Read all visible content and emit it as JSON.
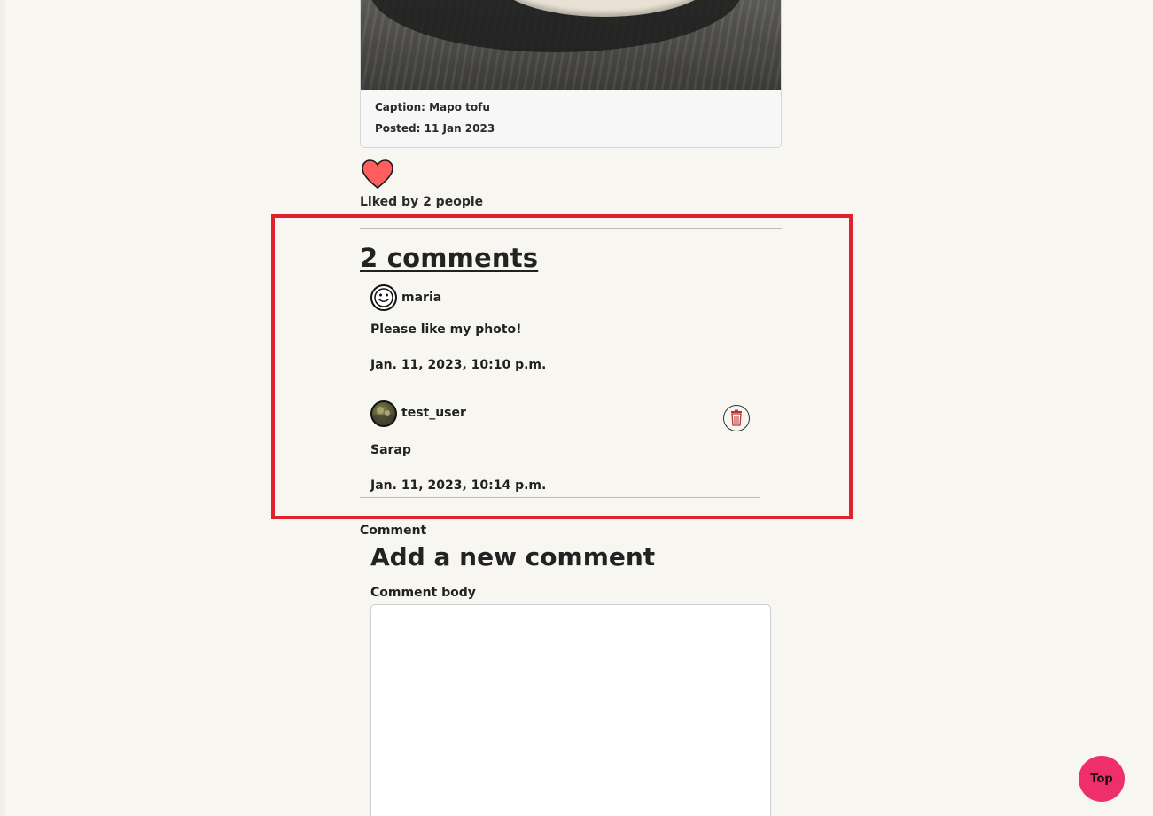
{
  "post": {
    "caption_label": "Caption: Mapo tofu",
    "posted_label": "Posted: 11 Jan 2023"
  },
  "likes": {
    "liked_by": "Liked by 2 people",
    "heart_color": "#ff5e5e"
  },
  "comments": {
    "heading": "2 comments",
    "items": [
      {
        "username": "maria",
        "avatar_icon": "smiley-icon",
        "body": "Please like my photo!",
        "date": "Jan. 11, 2023, 10:10 p.m.",
        "deletable": false
      },
      {
        "username": "test_user",
        "avatar_icon": "photo-avatar",
        "body": "Sarap",
        "date": "Jan. 11, 2023, 10:14 p.m.",
        "deletable": true,
        "delete_icon": "trash-icon"
      }
    ]
  },
  "comment_form": {
    "section_label": "Comment",
    "title": "Add a new comment",
    "body_label": "Comment body",
    "body_value": ""
  },
  "top_button": {
    "label": "Top",
    "color": "#ef2e6c"
  },
  "highlight_color": "#e0222c"
}
